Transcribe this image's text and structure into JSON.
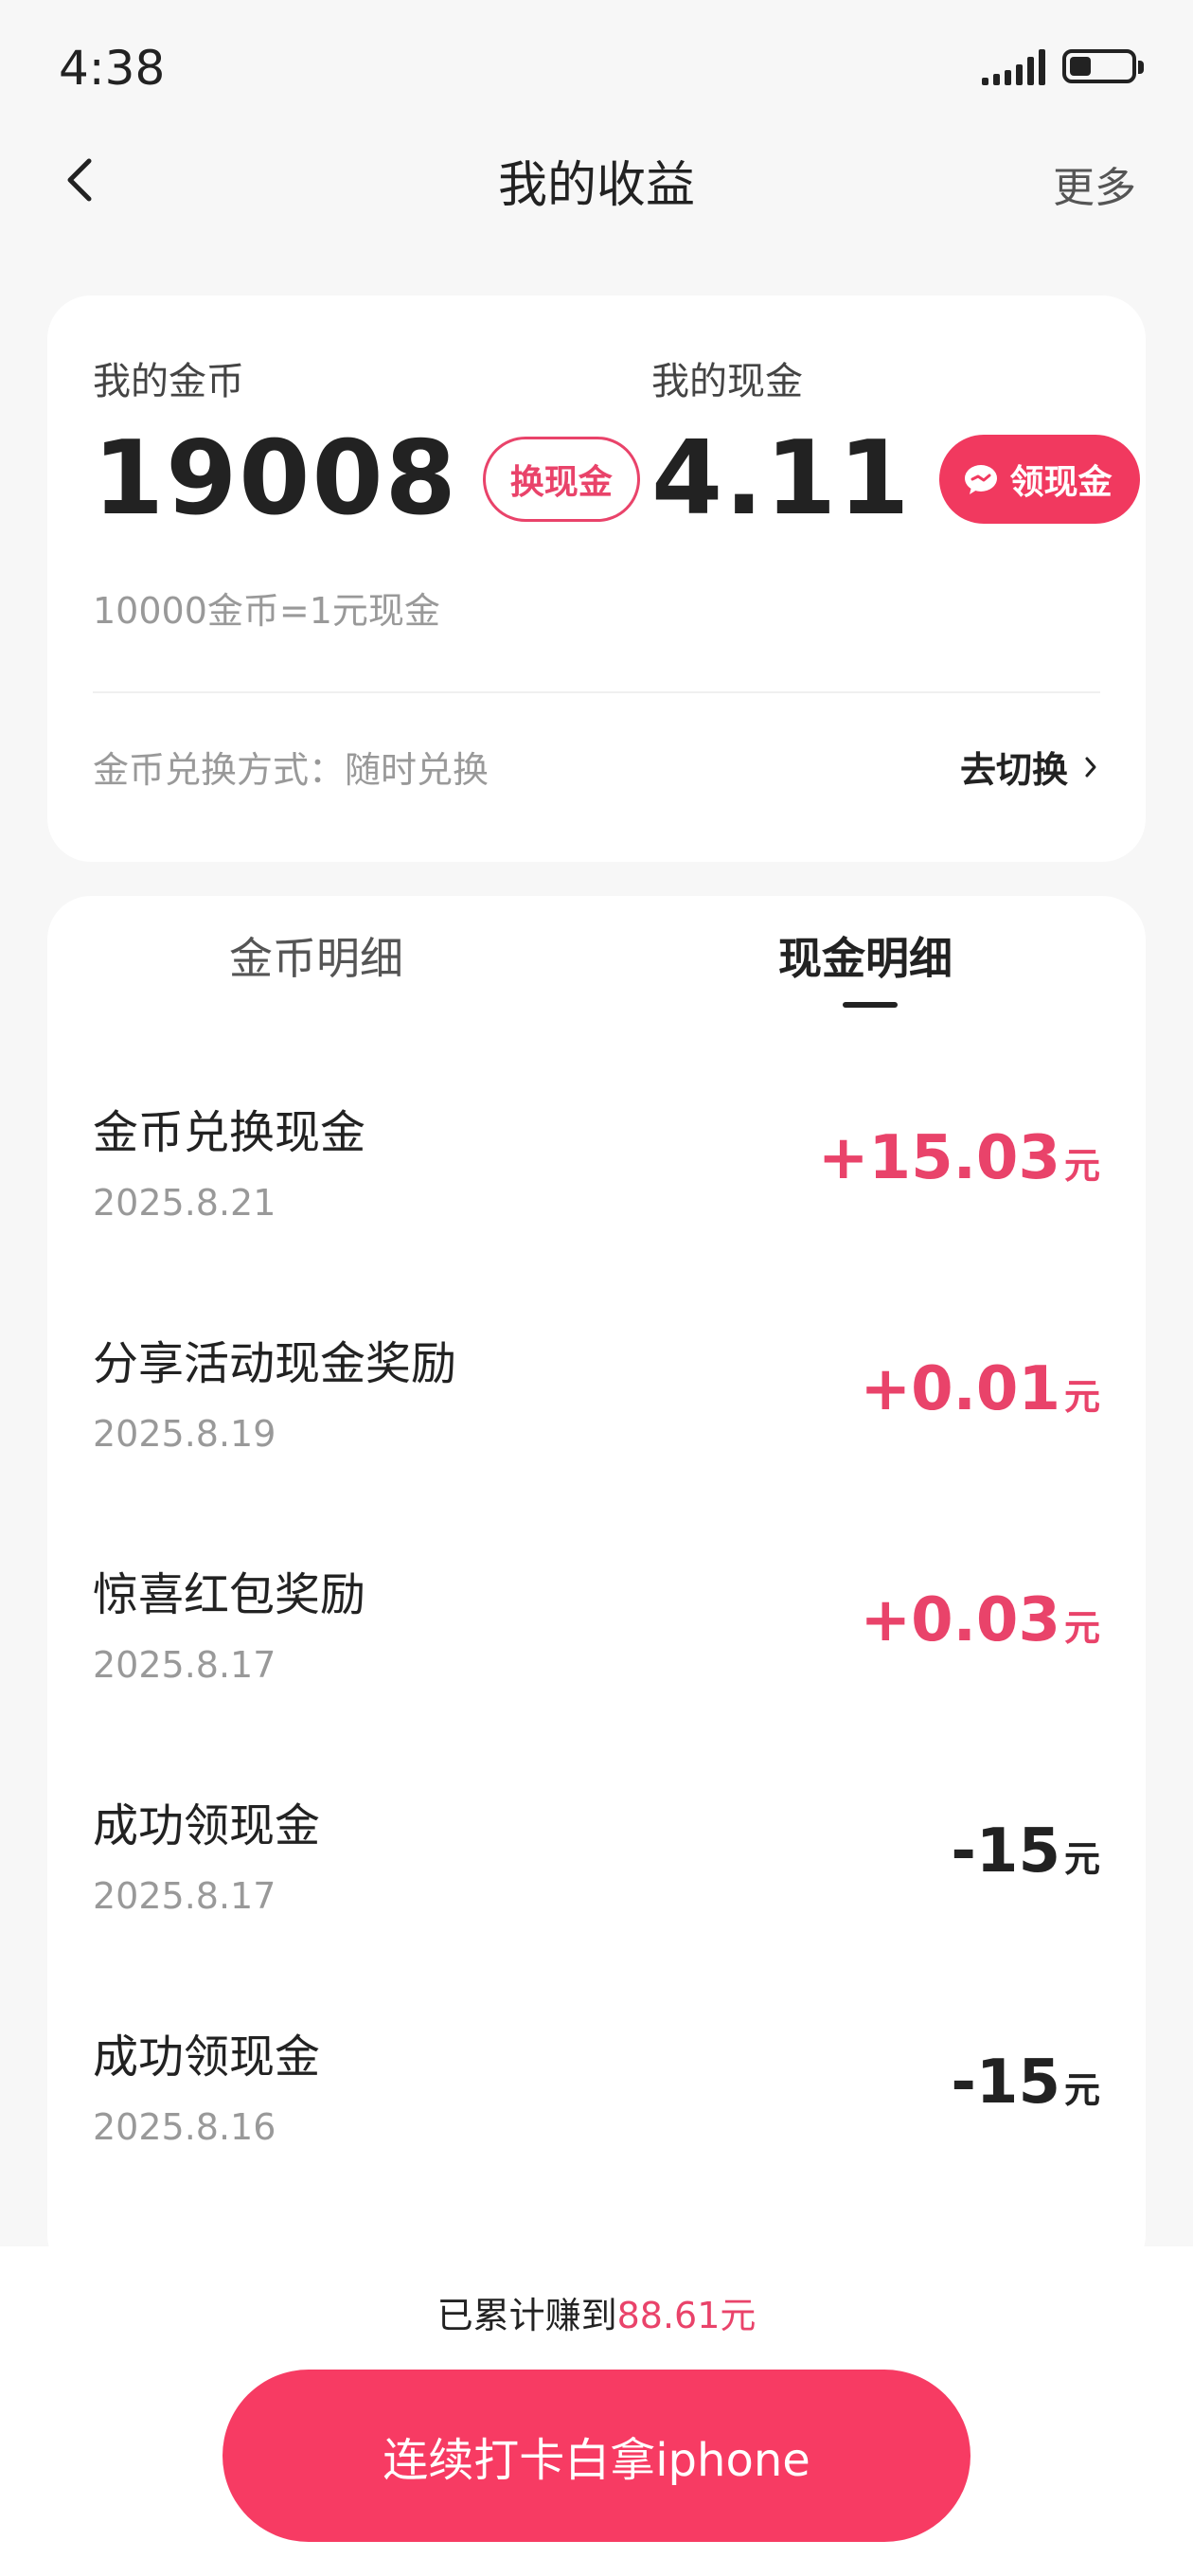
{
  "status": {
    "time": "4:38",
    "battery_level": 0.35
  },
  "nav": {
    "title": "我的收益",
    "more": "更多"
  },
  "summary": {
    "coins_label": "我的金币",
    "coins_value": "19008",
    "exchange_button": "换现金",
    "cash_label": "我的现金",
    "cash_value": "4.11",
    "withdraw_button": "领现金",
    "rate_note": "10000金币=1元现金",
    "exchange_mode": "金币兑换方式：随时兑换",
    "switch_link": "去切换"
  },
  "tabs": [
    {
      "label": "金币明细",
      "active": false
    },
    {
      "label": "现金明细",
      "active": true
    }
  ],
  "records": [
    {
      "title": "金币兑换现金",
      "date": "2025.8.21",
      "amount": "+15.03",
      "unit": "元",
      "positive": true
    },
    {
      "title": "分享活动现金奖励",
      "date": "2025.8.19",
      "amount": "+0.01",
      "unit": "元",
      "positive": true
    },
    {
      "title": "惊喜红包奖励",
      "date": "2025.8.17",
      "amount": "+0.03",
      "unit": "元",
      "positive": true
    },
    {
      "title": "成功领现金",
      "date": "2025.8.17",
      "amount": "-15",
      "unit": "元",
      "positive": false
    },
    {
      "title": "成功领现金",
      "date": "2025.8.16",
      "amount": "-15",
      "unit": "元",
      "positive": false
    }
  ],
  "footer": {
    "total_prefix": "已累计赚到",
    "total_value": "88.61元",
    "cta": "连续打卡白拿iphone"
  },
  "colors": {
    "accent": "#f1395f",
    "text": "#222222",
    "muted": "#999999"
  }
}
